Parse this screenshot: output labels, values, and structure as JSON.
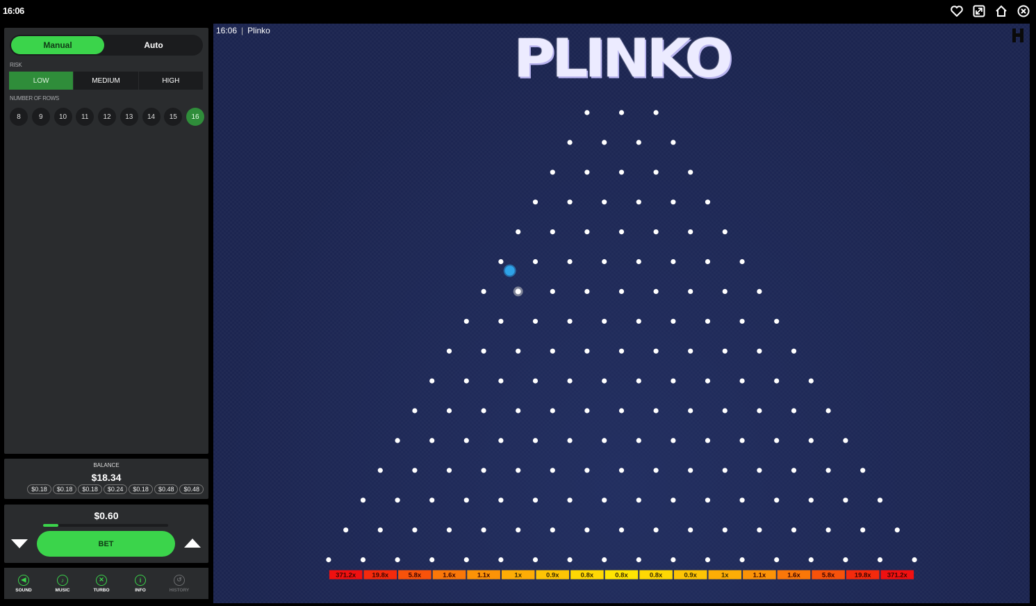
{
  "topbar": {
    "time": "16:06",
    "icons": [
      "heart-icon",
      "expand-icon",
      "home-icon",
      "close-icon"
    ]
  },
  "controls": {
    "mode_tabs": [
      "Manual",
      "Auto"
    ],
    "active_mode": "Manual",
    "risk_label": "RISK",
    "risk_options": [
      "LOW",
      "MEDIUM",
      "HIGH"
    ],
    "active_risk": "LOW",
    "rows_label": "NUMBER OF ROWS",
    "row_options": [
      "8",
      "9",
      "10",
      "11",
      "12",
      "13",
      "14",
      "15",
      "16"
    ],
    "active_rows": "16"
  },
  "balance": {
    "label": "BALANCE",
    "value": "$18.34",
    "recent_wins": [
      "$0.18",
      "$0.18",
      "$0.18",
      "$0.24",
      "$0.18",
      "$0.48",
      "$0.48"
    ]
  },
  "bet": {
    "amount": "$0.60",
    "slider_fraction": 0.12,
    "button_label": "BET"
  },
  "toolbar": [
    {
      "label": "SOUND",
      "icon": "sound-icon",
      "enabled": true
    },
    {
      "label": "MUSIC",
      "icon": "music-icon",
      "enabled": true
    },
    {
      "label": "TURBO",
      "icon": "turbo-icon",
      "enabled": true
    },
    {
      "label": "INFO",
      "icon": "info-icon",
      "enabled": true
    },
    {
      "label": "HISTORY",
      "icon": "history-icon",
      "enabled": false
    }
  ],
  "game": {
    "header_time": "16:06",
    "header_separator": "|",
    "header_name": "Plinko",
    "title": "PLINKO",
    "rows": 16,
    "multipliers": [
      "371.2x",
      "19.8x",
      "5.8x",
      "1.6x",
      "1.1x",
      "1x",
      "0.9x",
      "0.8x",
      "0.8x",
      "0.8x",
      "0.9x",
      "1x",
      "1.1x",
      "1.6x",
      "5.8x",
      "19.8x",
      "371.2x"
    ],
    "bucket_colors": [
      "#f01010",
      "#f52a0c",
      "#f8520a",
      "#fa7708",
      "#fc9306",
      "#fdad05",
      "#fec404",
      "#ffd803",
      "#ffe502",
      "#ffd803",
      "#fec404",
      "#fdad05",
      "#fc9306",
      "#fa7708",
      "#f8520a",
      "#f52a0c",
      "#f01010"
    ],
    "balls": [
      {
        "color": "#2ea3e8",
        "row": 5,
        "between": [
          0,
          1
        ]
      },
      {
        "color": "#c8c8c8",
        "row": 6,
        "peg": 1
      }
    ],
    "colors": {
      "accent": "#3bd44b",
      "panel": "#2a2c2e",
      "board": "#1c2550"
    }
  }
}
